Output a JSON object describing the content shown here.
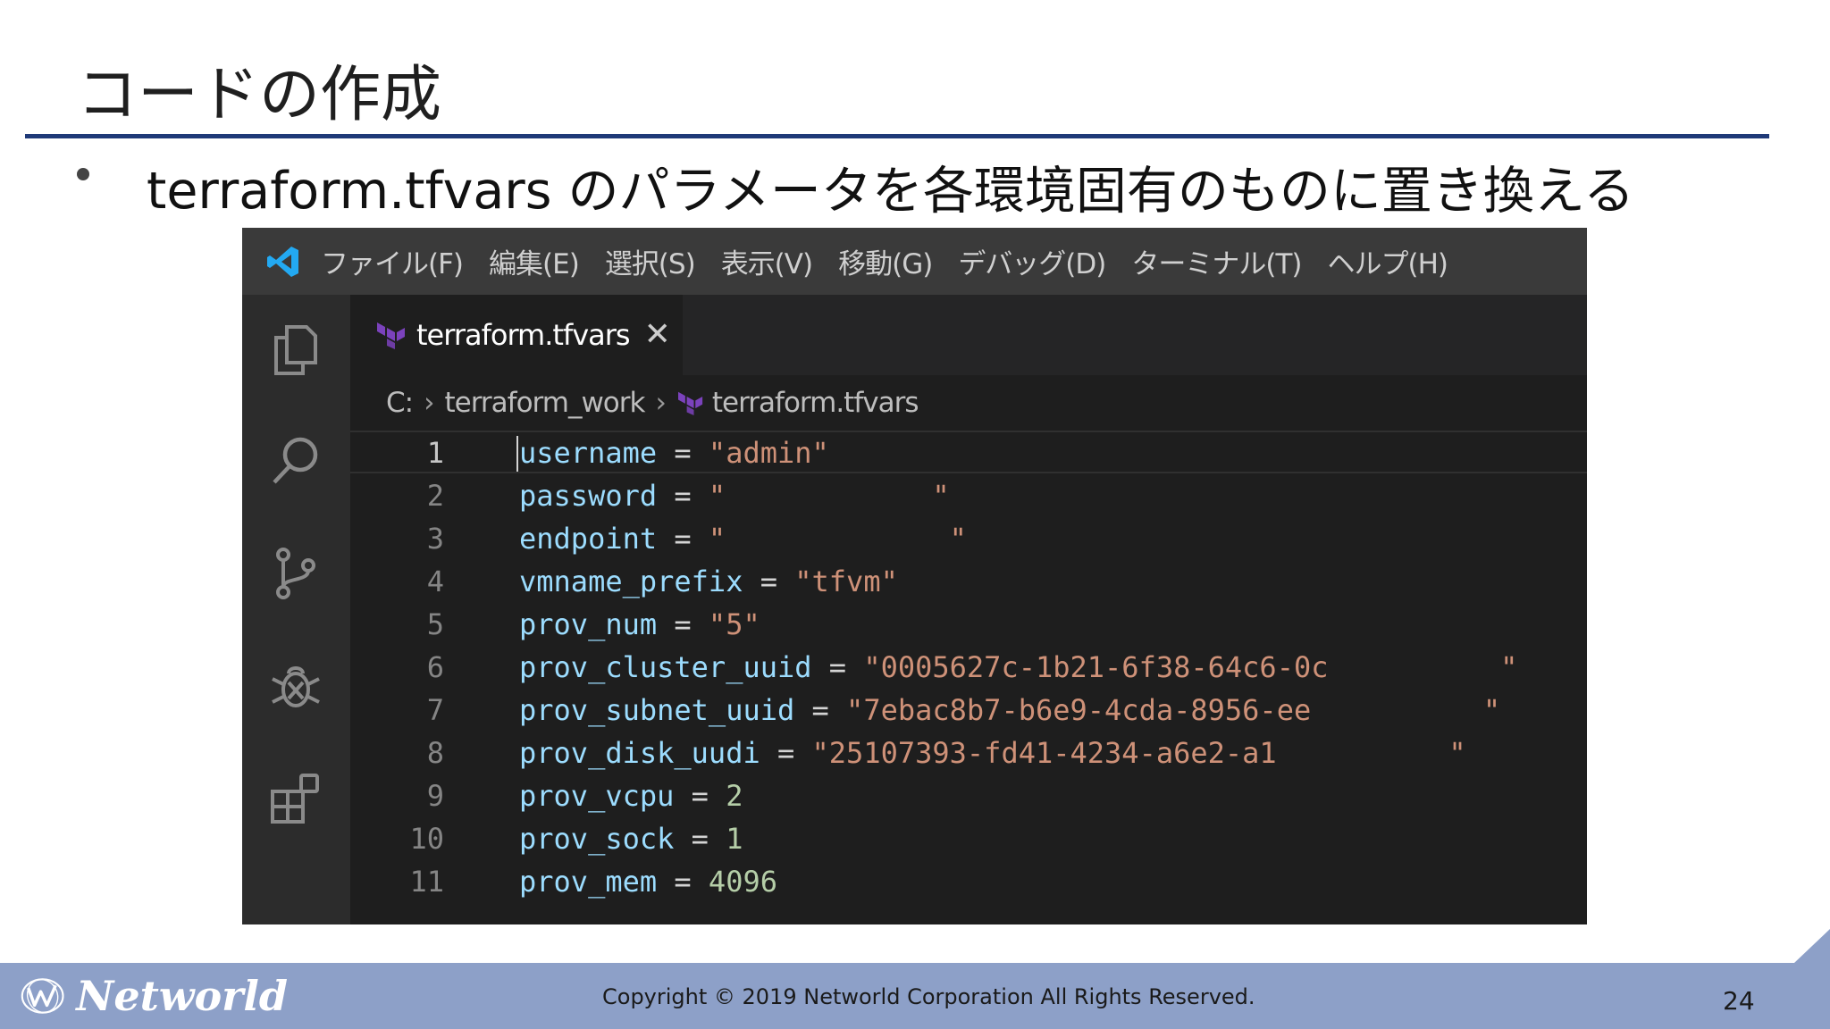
{
  "slide": {
    "title": "コードの作成",
    "bullet": "terraform.tfvars のパラメータを各環境固有のものに置き換える",
    "page_number": "24",
    "copyright": "Copyright © 2019 Networld Corporation All Rights Reserved.",
    "brand": "Networld"
  },
  "menubar": {
    "items": [
      "ファイル(F)",
      "編集(E)",
      "選択(S)",
      "表示(V)",
      "移動(G)",
      "デバッグ(D)",
      "ターミナル(T)",
      "ヘルプ(H)"
    ]
  },
  "activity_bar": {
    "icons": [
      "files-icon",
      "search-icon",
      "source-control-icon",
      "debug-icon",
      "extensions-icon"
    ]
  },
  "tab": {
    "label": "terraform.tfvars",
    "close_glyph": "✕"
  },
  "breadcrumb": {
    "drive": "C:",
    "folder": "terraform_work",
    "file": "terraform.tfvars",
    "separator": "›"
  },
  "code": {
    "lines": [
      {
        "num": "1",
        "name": "username",
        "eq": "=",
        "value": "\"admin\"",
        "type": "str"
      },
      {
        "num": "2",
        "name": "password",
        "eq": "=",
        "value": "\"            \"",
        "type": "str"
      },
      {
        "num": "3",
        "name": "endpoint",
        "eq": "=",
        "value": "\"             \"",
        "type": "str"
      },
      {
        "num": "4",
        "name": "vmname_prefix",
        "eq": "=",
        "value": "\"tfvm\"",
        "type": "str"
      },
      {
        "num": "5",
        "name": "prov_num",
        "eq": "=",
        "value": "\"5\"",
        "type": "str"
      },
      {
        "num": "6",
        "name": "prov_cluster_uuid",
        "eq": "=",
        "value": "\"0005627c-1b21-6f38-64c6-0c          \"",
        "type": "str"
      },
      {
        "num": "7",
        "name": "prov_subnet_uuid",
        "eq": "=",
        "value": "\"7ebac8b7-b6e9-4cda-8956-ee          \"",
        "type": "str"
      },
      {
        "num": "8",
        "name": "prov_disk_uudi",
        "eq": "=",
        "value": "\"25107393-fd41-4234-a6e2-a1          \"",
        "type": "str"
      },
      {
        "num": "9",
        "name": "prov_vcpu",
        "eq": "=",
        "value": "2",
        "type": "num"
      },
      {
        "num": "10",
        "name": "prov_sock",
        "eq": "=",
        "value": "1",
        "type": "num"
      },
      {
        "num": "11",
        "name": "prov_mem",
        "eq": "=",
        "value": "4096",
        "type": "num"
      }
    ]
  },
  "colors": {
    "title_rule": "#1f3a78",
    "footer": "#8da0c8",
    "vscode_blue": "#23a9f2",
    "terraform_purple": "#7b42bc",
    "var": "#9cdcfe",
    "string": "#ce9178",
    "number": "#b5cea8"
  }
}
